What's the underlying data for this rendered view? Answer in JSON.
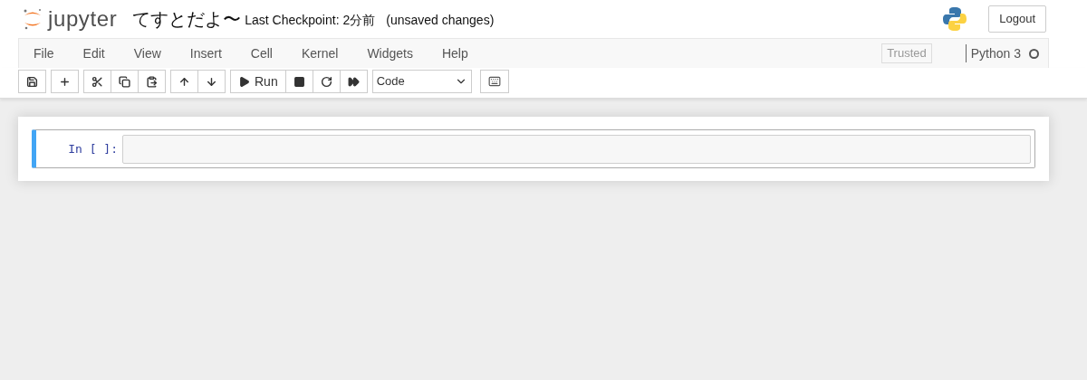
{
  "header": {
    "logo_text": "jupyter",
    "notebook_name": "てすとだよ〜",
    "checkpoint": "Last Checkpoint: 2分前",
    "autosave_status": "(unsaved changes)",
    "logout": "Logout"
  },
  "menu": [
    "File",
    "Edit",
    "View",
    "Insert",
    "Cell",
    "Kernel",
    "Widgets",
    "Help"
  ],
  "trusted": "Trusted",
  "kernel": {
    "name": "Python 3",
    "busy": false
  },
  "toolbar": {
    "groups": [
      [
        {
          "kind": "save"
        }
      ],
      [
        {
          "kind": "add"
        }
      ],
      [
        {
          "kind": "cut"
        },
        {
          "kind": "copy"
        },
        {
          "kind": "paste"
        }
      ],
      [
        {
          "kind": "up"
        },
        {
          "kind": "down"
        }
      ],
      [
        {
          "kind": "run"
        },
        {
          "kind": "stop"
        },
        {
          "kind": "restart"
        },
        {
          "kind": "run-all"
        }
      ]
    ],
    "run_label": "Run",
    "cell_type": "Code"
  },
  "cells": [
    {
      "prompt": "In [ ]:",
      "selected": true
    }
  ]
}
